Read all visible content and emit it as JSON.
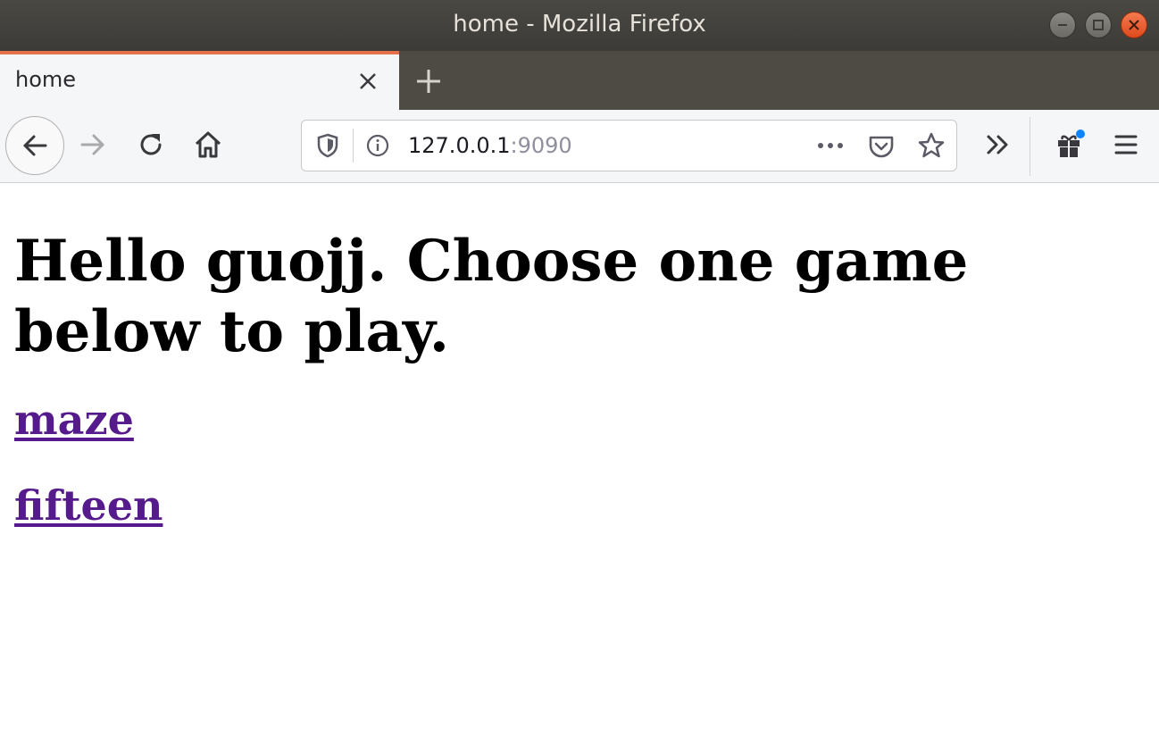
{
  "window": {
    "title": "home - Mozilla Firefox",
    "controls": [
      "minimize",
      "maximize",
      "close"
    ]
  },
  "tabs": [
    {
      "label": "home",
      "active": true
    }
  ],
  "toolbar": {
    "url_host": "127.0.0.1",
    "url_port": ":9090",
    "icons": [
      "back-icon",
      "forward-icon",
      "reload-icon",
      "home-icon",
      "tracking-shield-icon",
      "site-info-icon",
      "page-actions-icon",
      "pocket-icon",
      "bookmark-star-icon",
      "overflow-icon",
      "gift-icon",
      "menu-icon"
    ]
  },
  "page": {
    "heading": "Hello guojj. Choose one game below to play.",
    "links": [
      {
        "label": "maze"
      },
      {
        "label": "fifteen"
      }
    ]
  },
  "colors": {
    "titlebar": "#3c3b37",
    "tab_accent": "#e4714a",
    "visited_link": "#551a8b",
    "close_button": "#e95420"
  }
}
